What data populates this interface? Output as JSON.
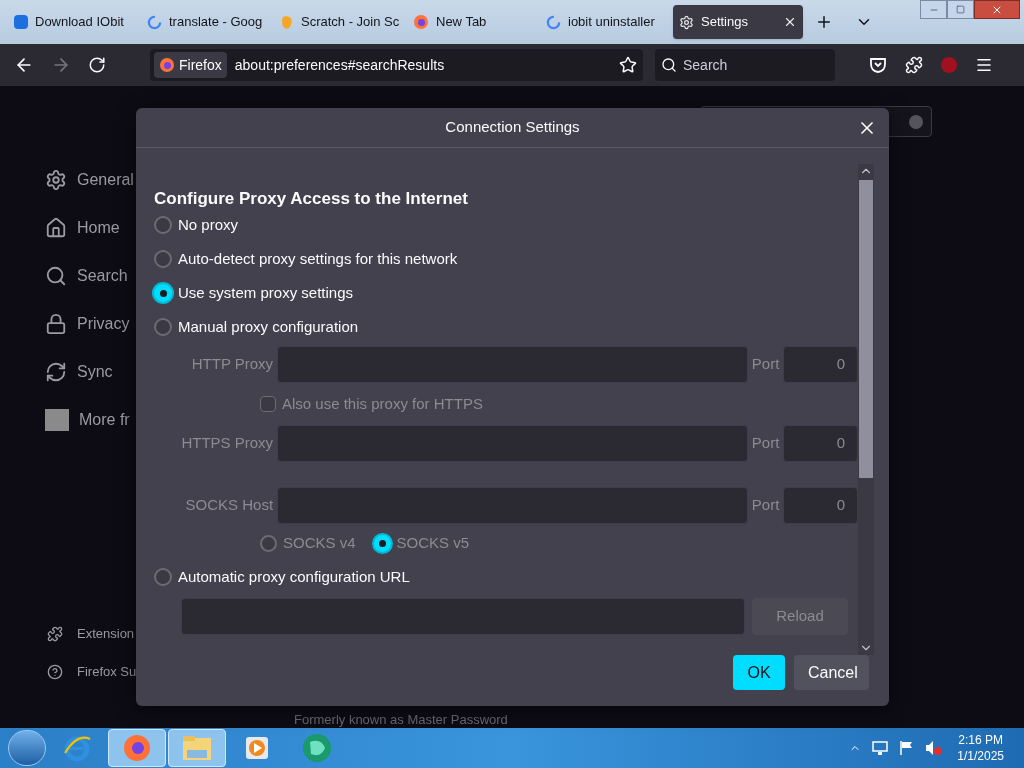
{
  "tabs": [
    {
      "title": "Download IObit",
      "selected": false
    },
    {
      "title": "translate - Goog",
      "selected": false
    },
    {
      "title": "Scratch - Join Sc",
      "selected": false
    },
    {
      "title": "New Tab",
      "selected": false
    },
    {
      "title": "iobit uninstaller",
      "selected": false
    },
    {
      "title": "Settings",
      "selected": true
    }
  ],
  "toolbar": {
    "identity": "Firefox",
    "url": "about:preferences#searchResults",
    "search_placeholder": "Search"
  },
  "sidebar": {
    "items": [
      {
        "label": "General"
      },
      {
        "label": "Home"
      },
      {
        "label": "Search"
      },
      {
        "label": "Privacy"
      },
      {
        "label": "Sync"
      },
      {
        "label": "More fr"
      }
    ],
    "footer": [
      {
        "label": "Extension"
      },
      {
        "label": "Firefox Su"
      }
    ]
  },
  "page_footnote": "Formerly known as Master Password",
  "dialog": {
    "title": "Connection Settings",
    "heading": "Configure Proxy Access to the Internet",
    "proxy_options": [
      {
        "label": "No proxy",
        "selected": false
      },
      {
        "label": "Auto-detect proxy settings for this network",
        "selected": false
      },
      {
        "label": "Use system proxy settings",
        "selected": true
      },
      {
        "label": "Manual proxy configuration",
        "selected": false
      }
    ],
    "manual": {
      "disabled": true,
      "http": {
        "label": "HTTP Proxy",
        "port_label": "Port",
        "port": "0"
      },
      "also_https": {
        "label": "Also use this proxy for HTTPS",
        "checked": false
      },
      "https": {
        "label": "HTTPS Proxy",
        "port_label": "Port",
        "port": "0"
      },
      "socks": {
        "label": "SOCKS Host",
        "port_label": "Port",
        "port": "0"
      },
      "socks_versions": [
        {
          "label": "SOCKS v4",
          "selected": false
        },
        {
          "label": "SOCKS v5",
          "selected": true
        }
      ]
    },
    "auto_url": {
      "label": "Automatic proxy configuration URL",
      "selected": false,
      "reload": "Reload",
      "disabled": true
    },
    "buttons": [
      {
        "label": "OK",
        "kind": "primary"
      },
      {
        "label": "Cancel",
        "kind": "secondary"
      }
    ]
  },
  "taskbar": {
    "apps": [
      {
        "active": false
      },
      {
        "active": true
      },
      {
        "active": true
      },
      {
        "active": false
      },
      {
        "active": false
      }
    ],
    "time": "2:16 PM",
    "date": "1/1/2025"
  }
}
